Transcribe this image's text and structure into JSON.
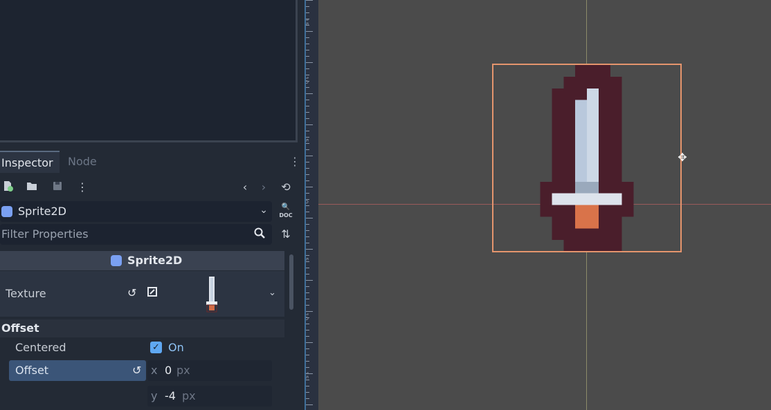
{
  "tabs": {
    "inspector": "Inspector",
    "node": "Node"
  },
  "toolbar": {
    "new_resource_icon": "new-resource-icon",
    "open_icon": "folder-open-icon",
    "save_icon": "save-icon",
    "menu_icon": "kebab-menu-icon",
    "back_icon": "chevron-left-icon",
    "forward_icon": "chevron-right-icon",
    "history_icon": "history-icon"
  },
  "node_selector": {
    "value": "Sprite2D",
    "doc_label": "DOC"
  },
  "filter": {
    "placeholder": "Filter Properties"
  },
  "class_header": {
    "label": "Sprite2D"
  },
  "properties": {
    "texture_label": "Texture",
    "offset_group": "Offset",
    "centered_label": "Centered",
    "centered_value": "On",
    "offset_label": "Offset",
    "offset_x_axis": "x",
    "offset_x": "0",
    "offset_y_axis": "y",
    "offset_y": "-4",
    "unit": "px"
  },
  "ruler": {
    "labels": [
      "15",
      "10",
      "5",
      "0",
      "5",
      "10",
      "15"
    ]
  },
  "colors": {
    "accent": "#5fa8f2",
    "selection": "#e5956d",
    "panel": "#232a35",
    "viewport": "#4b4b4b"
  }
}
